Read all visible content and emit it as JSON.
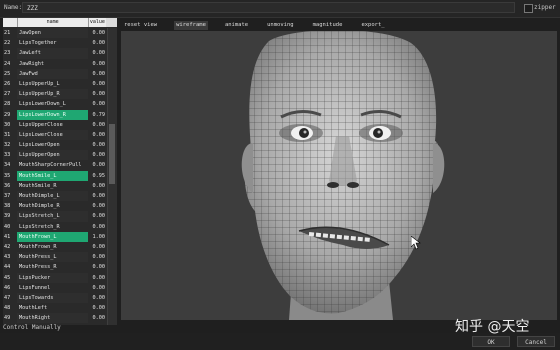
{
  "name_bar": {
    "label": "Name:",
    "value": "ZZZ",
    "checkbox_label": "zipper"
  },
  "table": {
    "headers": {
      "name": "name",
      "value": "value"
    },
    "rows": [
      {
        "num": "21",
        "name": "JawOpen",
        "value": "0.00",
        "highlight": false
      },
      {
        "num": "22",
        "name": "LipsTogether",
        "value": "0.00",
        "highlight": false
      },
      {
        "num": "23",
        "name": "JawLeft",
        "value": "0.00",
        "highlight": false
      },
      {
        "num": "24",
        "name": "JawRight",
        "value": "0.00",
        "highlight": false
      },
      {
        "num": "25",
        "name": "JawFwd",
        "value": "0.00",
        "highlight": false
      },
      {
        "num": "26",
        "name": "LipsUpperUp_L",
        "value": "0.00",
        "highlight": false
      },
      {
        "num": "27",
        "name": "LipsUpperUp_R",
        "value": "0.00",
        "highlight": false
      },
      {
        "num": "28",
        "name": "LipsLowerDown_L",
        "value": "0.00",
        "highlight": false
      },
      {
        "num": "29",
        "name": "LipsLowerDown_R",
        "value": "0.79",
        "highlight": true
      },
      {
        "num": "30",
        "name": "LipsUpperClose",
        "value": "0.00",
        "highlight": false
      },
      {
        "num": "31",
        "name": "LipsLowerClose",
        "value": "0.00",
        "highlight": false
      },
      {
        "num": "32",
        "name": "LipsLowerOpen",
        "value": "0.00",
        "highlight": false
      },
      {
        "num": "33",
        "name": "LipsUpperOpen",
        "value": "0.00",
        "highlight": false
      },
      {
        "num": "34",
        "name": "MouthSharpCornerPull",
        "value": "0.00",
        "highlight": false
      },
      {
        "num": "35",
        "name": "MouthSmile_L",
        "value": "0.95",
        "highlight": true
      },
      {
        "num": "36",
        "name": "MouthSmile_R",
        "value": "0.00",
        "highlight": false
      },
      {
        "num": "37",
        "name": "MouthDimple_L",
        "value": "0.00",
        "highlight": false
      },
      {
        "num": "38",
        "name": "MouthDimple_R",
        "value": "0.00",
        "highlight": false
      },
      {
        "num": "39",
        "name": "LipsStretch_L",
        "value": "0.00",
        "highlight": false
      },
      {
        "num": "40",
        "name": "LipsStretch_R",
        "value": "0.00",
        "highlight": false
      },
      {
        "num": "41",
        "name": "MouthFrown_L",
        "value": "1.00",
        "highlight": true
      },
      {
        "num": "42",
        "name": "MouthFrown_R",
        "value": "0.00",
        "highlight": false
      },
      {
        "num": "43",
        "name": "MouthPress_L",
        "value": "0.00",
        "highlight": false
      },
      {
        "num": "44",
        "name": "MouthPress_R",
        "value": "0.00",
        "highlight": false
      },
      {
        "num": "45",
        "name": "LipsPucker",
        "value": "0.00",
        "highlight": false
      },
      {
        "num": "46",
        "name": "LipsFunnel",
        "value": "0.00",
        "highlight": false
      },
      {
        "num": "47",
        "name": "LipsTowards",
        "value": "0.00",
        "highlight": false
      },
      {
        "num": "48",
        "name": "MouthLeft",
        "value": "0.00",
        "highlight": false
      },
      {
        "num": "49",
        "name": "MouthRight",
        "value": "0.00",
        "highlight": false
      }
    ]
  },
  "control_manually": "Control Manually",
  "tabs": [
    "reset view",
    "wireframe",
    "animate",
    "unmoving",
    "magnitude",
    "export_"
  ],
  "active_tab": "wireframe",
  "buttons": {
    "ok": "OK",
    "cancel": "Cancel"
  },
  "watermark": "知乎 @天空",
  "colors": {
    "highlight": "#1fa772",
    "viewport_bg": "#3d3d3d",
    "window_bg": "#1f1f1f"
  }
}
